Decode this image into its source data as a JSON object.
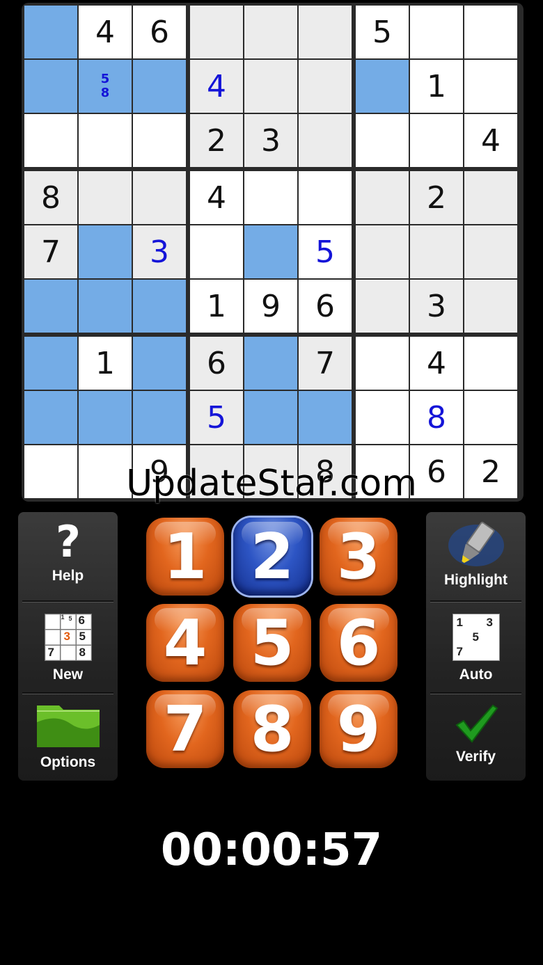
{
  "board": {
    "rows": [
      [
        {
          "v": "",
          "bg": "blue"
        },
        {
          "v": "4",
          "bg": "white"
        },
        {
          "v": "6",
          "bg": "white"
        },
        {
          "v": "",
          "bg": "gray"
        },
        {
          "v": "",
          "bg": "gray"
        },
        {
          "v": "",
          "bg": "gray"
        },
        {
          "v": "5",
          "bg": "white"
        },
        {
          "v": "",
          "bg": "white"
        },
        {
          "v": "",
          "bg": "white"
        }
      ],
      [
        {
          "v": "",
          "bg": "blue"
        },
        {
          "v": "",
          "bg": "blue",
          "pencil": [
            "5",
            "8"
          ]
        },
        {
          "v": "",
          "bg": "blue"
        },
        {
          "v": "4",
          "bg": "gray",
          "user": true
        },
        {
          "v": "",
          "bg": "gray"
        },
        {
          "v": "",
          "bg": "gray"
        },
        {
          "v": "",
          "bg": "blue"
        },
        {
          "v": "1",
          "bg": "white"
        },
        {
          "v": "",
          "bg": "white"
        }
      ],
      [
        {
          "v": "",
          "bg": "white"
        },
        {
          "v": "",
          "bg": "white"
        },
        {
          "v": "",
          "bg": "white"
        },
        {
          "v": "2",
          "bg": "gray"
        },
        {
          "v": "3",
          "bg": "gray"
        },
        {
          "v": "",
          "bg": "gray"
        },
        {
          "v": "",
          "bg": "white"
        },
        {
          "v": "",
          "bg": "white"
        },
        {
          "v": "4",
          "bg": "white"
        }
      ],
      [
        {
          "v": "8",
          "bg": "gray"
        },
        {
          "v": "",
          "bg": "gray"
        },
        {
          "v": "",
          "bg": "gray"
        },
        {
          "v": "4",
          "bg": "white"
        },
        {
          "v": "",
          "bg": "white"
        },
        {
          "v": "",
          "bg": "white"
        },
        {
          "v": "",
          "bg": "gray"
        },
        {
          "v": "2",
          "bg": "gray"
        },
        {
          "v": "",
          "bg": "gray"
        }
      ],
      [
        {
          "v": "7",
          "bg": "gray"
        },
        {
          "v": "",
          "bg": "blue"
        },
        {
          "v": "3",
          "bg": "gray",
          "user": true
        },
        {
          "v": "",
          "bg": "white"
        },
        {
          "v": "",
          "bg": "blue"
        },
        {
          "v": "5",
          "bg": "white",
          "user": true
        },
        {
          "v": "",
          "bg": "gray"
        },
        {
          "v": "",
          "bg": "gray"
        },
        {
          "v": "",
          "bg": "gray"
        }
      ],
      [
        {
          "v": "",
          "bg": "blue"
        },
        {
          "v": "",
          "bg": "blue"
        },
        {
          "v": "",
          "bg": "blue"
        },
        {
          "v": "1",
          "bg": "white"
        },
        {
          "v": "9",
          "bg": "white"
        },
        {
          "v": "6",
          "bg": "white"
        },
        {
          "v": "",
          "bg": "gray"
        },
        {
          "v": "3",
          "bg": "gray"
        },
        {
          "v": "",
          "bg": "gray"
        }
      ],
      [
        {
          "v": "",
          "bg": "blue"
        },
        {
          "v": "1",
          "bg": "white"
        },
        {
          "v": "",
          "bg": "blue"
        },
        {
          "v": "6",
          "bg": "gray"
        },
        {
          "v": "",
          "bg": "blue"
        },
        {
          "v": "7",
          "bg": "gray"
        },
        {
          "v": "",
          "bg": "white"
        },
        {
          "v": "4",
          "bg": "white"
        },
        {
          "v": "",
          "bg": "white"
        }
      ],
      [
        {
          "v": "",
          "bg": "blue"
        },
        {
          "v": "",
          "bg": "blue"
        },
        {
          "v": "",
          "bg": "blue"
        },
        {
          "v": "5",
          "bg": "gray",
          "user": true
        },
        {
          "v": "",
          "bg": "blue"
        },
        {
          "v": "",
          "bg": "blue"
        },
        {
          "v": "",
          "bg": "white"
        },
        {
          "v": "8",
          "bg": "white",
          "user": true
        },
        {
          "v": "",
          "bg": "white"
        }
      ],
      [
        {
          "v": "",
          "bg": "white"
        },
        {
          "v": "",
          "bg": "white"
        },
        {
          "v": "9",
          "bg": "white"
        },
        {
          "v": "",
          "bg": "gray"
        },
        {
          "v": "",
          "bg": "gray"
        },
        {
          "v": "8",
          "bg": "gray"
        },
        {
          "v": "",
          "bg": "white"
        },
        {
          "v": "6",
          "bg": "white"
        },
        {
          "v": "2",
          "bg": "white"
        }
      ]
    ],
    "colors": {
      "blue": "#74ace6",
      "gray": "#ececec",
      "white": "#ffffff",
      "user_digit": "#1414d8"
    }
  },
  "watermark": "UpdateStar.com",
  "left_panel": {
    "help": "Help",
    "new": "New",
    "options": "Options"
  },
  "new_icon": {
    "d1": "1",
    "d2": "5",
    "d3": "6",
    "center": "3",
    "d5": "5",
    "d7": "7",
    "d8": "8"
  },
  "right_panel": {
    "highlight": "Highlight",
    "auto": "Auto",
    "verify": "Verify"
  },
  "auto_icon": {
    "a": "1",
    "b": "3",
    "c": "5",
    "d": "7"
  },
  "numpad": {
    "digits": [
      "1",
      "2",
      "3",
      "4",
      "5",
      "6",
      "7",
      "8",
      "9"
    ],
    "selected": "2"
  },
  "timer": "00:00:57"
}
